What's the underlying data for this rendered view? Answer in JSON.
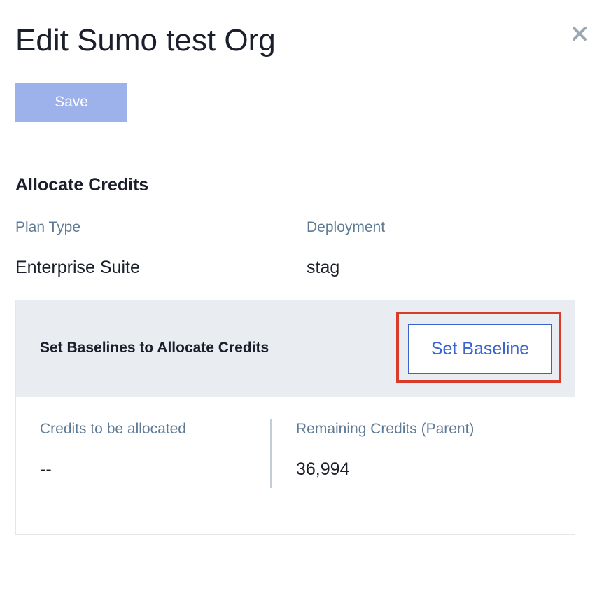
{
  "dialog": {
    "title": "Edit Sumo test Org",
    "close_icon": "close-icon",
    "save_label": "Save"
  },
  "allocate_credits": {
    "section_title": "Allocate Credits",
    "plan_type": {
      "label": "Plan Type",
      "value": "Enterprise Suite"
    },
    "deployment": {
      "label": "Deployment",
      "value": "stag"
    }
  },
  "baseline_card": {
    "header_title": "Set Baselines to Allocate Credits",
    "button_label": "Set Baseline",
    "highlight_color": "#d93b2b",
    "credits_to_allocate": {
      "label": "Credits to be allocated",
      "value": "--"
    },
    "remaining_credits": {
      "label": "Remaining Credits (Parent)",
      "value": "36,994"
    }
  },
  "colors": {
    "save_button_bg": "#9db2ea",
    "accent_blue": "#3a63cf",
    "label_gray_blue": "#5f7a94",
    "card_header_bg": "#e9edf1"
  }
}
